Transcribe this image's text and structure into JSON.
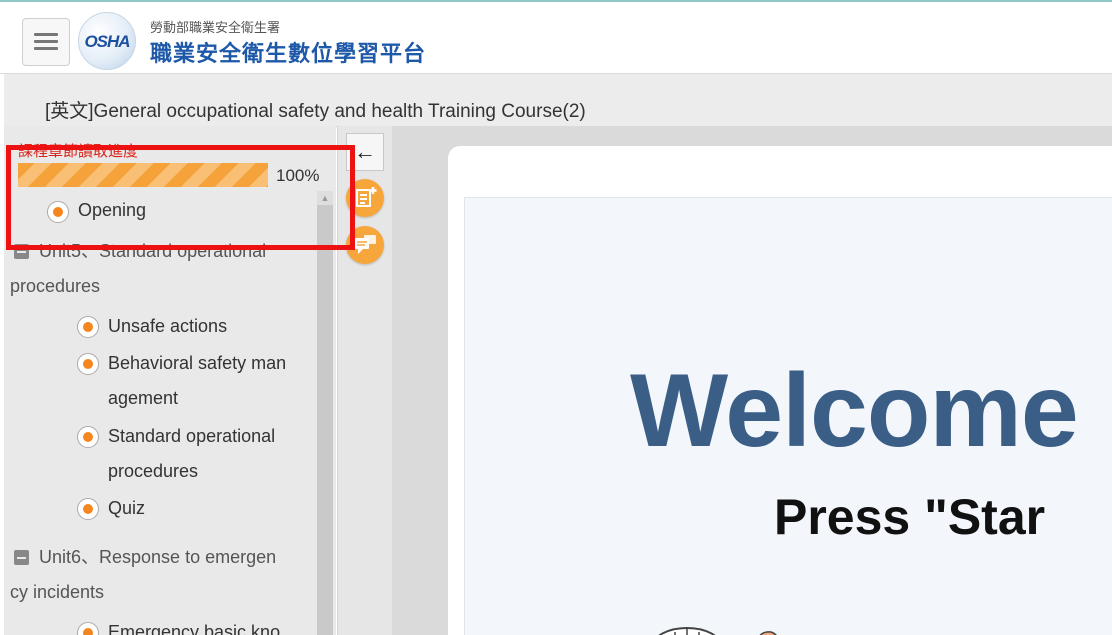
{
  "header": {
    "org_name": "勞動部職業安全衛生署",
    "platform_name": "職業安全衛生數位學習平台",
    "logo_text": "OSHA",
    "menu_icon": "hamburger-icon"
  },
  "course": {
    "title": "[英文]General occupational safety and health Training Course(2)"
  },
  "progress": {
    "label": "課程章節讀取進度",
    "value": 1.0,
    "percent_text": "100%"
  },
  "outline": {
    "opening": "Opening",
    "units": [
      {
        "title_line1": "Unit5、Standard operational",
        "title_line2": "procedures",
        "items": [
          {
            "line1": "Unsafe actions",
            "line2": ""
          },
          {
            "line1": "Behavioral safety man",
            "line2": "agement"
          },
          {
            "line1": "Standard operational",
            "line2": "procedures"
          },
          {
            "line1": "Quiz",
            "line2": ""
          }
        ]
      },
      {
        "title_line1": "Unit6、Response to emergen",
        "title_line2": "cy incidents",
        "items": [
          {
            "line1": "Emergency basic kno",
            "line2": ""
          }
        ]
      }
    ]
  },
  "tools": {
    "back": "←",
    "back_icon": "arrow-left-icon",
    "notes_icon": "add-note-icon",
    "discussion_icon": "discussion-icon"
  },
  "slide": {
    "welcome": "Welcome",
    "press": "Press \"Star"
  },
  "colors": {
    "accent": "#f6a23b",
    "highlight_box": "#ee1111",
    "progress_label": "#d9251d",
    "welcome_text": "#3b5e87"
  }
}
